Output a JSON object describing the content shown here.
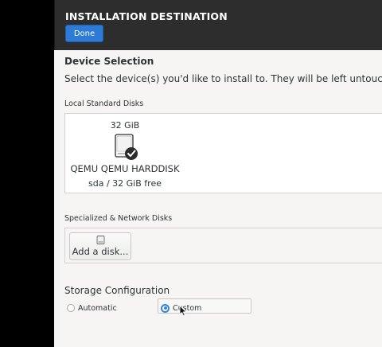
{
  "header": {
    "title": "INSTALLATION DESTINATION",
    "done_label": "Done"
  },
  "device_selection": {
    "title": "Device Selection",
    "description": "Select the device(s) you'd like to install to.  They will be left untouched ur"
  },
  "local_disks": {
    "label": "Local Standard Disks",
    "disks": [
      {
        "size": "32 GiB",
        "name": "QEMU QEMU HARDDISK",
        "free": "sda   /   32 GiB free",
        "selected": true,
        "icon": "harddisk-checked-icon"
      }
    ]
  },
  "network_disks": {
    "label": "Specialized & Network Disks",
    "add_label": "Add a disk..."
  },
  "storage_config": {
    "title": "Storage Configuration",
    "options": [
      {
        "label": "Automatic",
        "selected": false
      },
      {
        "label": "Custom",
        "selected": true
      }
    ]
  },
  "colors": {
    "accent": "#3584e4",
    "done_button": "#2d7bd6",
    "header_bg": "#2d2d2d",
    "content_bg": "#f6f5f4"
  }
}
